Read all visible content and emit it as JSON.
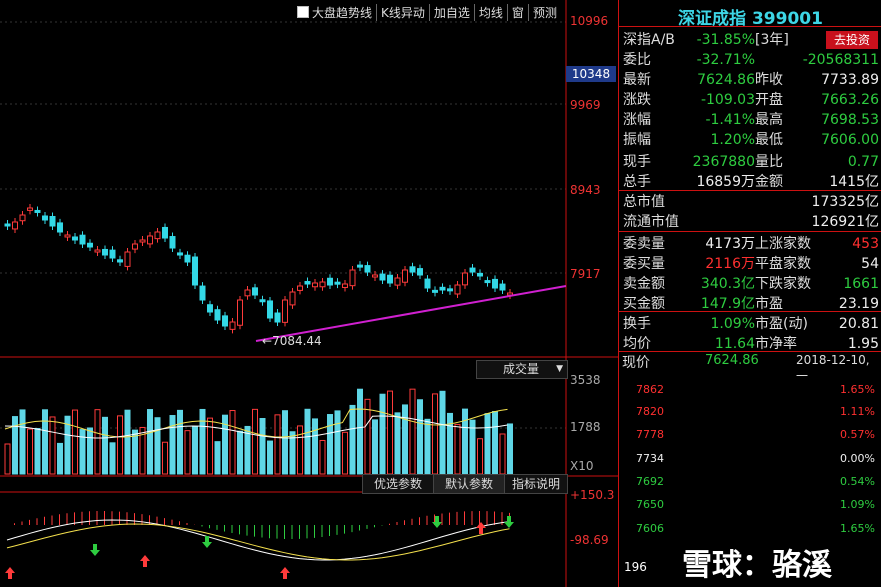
{
  "toolbar": {
    "items": [
      "大盘趋势线",
      "K线异动",
      "加自选",
      "均线",
      "窗",
      "预测"
    ]
  },
  "main_axis": {
    "labels": [
      "10996",
      "10348",
      "9969",
      "8943",
      "7917"
    ],
    "current_tag": "10348",
    "low_label": "7084.44"
  },
  "volume": {
    "title": "成交量",
    "axis_labels": [
      "3538",
      "1788"
    ],
    "unit": "X10"
  },
  "indicator": {
    "tabs": [
      "优选参数",
      "默认参数",
      "指标说明"
    ],
    "axis_labels": [
      "+150.3",
      "-98.69"
    ]
  },
  "panel": {
    "title": "深证成指 399001",
    "invest_button": "去投资",
    "rows": [
      {
        "l": "深指A/B",
        "v1": "-31.85%",
        "v1c": "green",
        "l2": "[3年]",
        "v2": "",
        "v2c": "white"
      },
      {
        "l": "委比",
        "v1": "-32.71%",
        "v1c": "green",
        "l2": "",
        "v2": "-20568311",
        "v2c": "green"
      },
      {
        "l": "最新",
        "v1": "7624.86",
        "v1c": "green",
        "l2": "昨收",
        "v2": "7733.89",
        "v2c": "white"
      },
      {
        "l": "涨跌",
        "v1": "-109.03",
        "v1c": "green",
        "l2": "开盘",
        "v2": "7663.26",
        "v2c": "green"
      },
      {
        "l": "涨幅",
        "v1": "-1.41%",
        "v1c": "green",
        "l2": "最高",
        "v2": "7698.53",
        "v2c": "green"
      },
      {
        "l": "振幅",
        "v1": "1.20%",
        "v1c": "green",
        "l2": "最低",
        "v2": "7606.00",
        "v2c": "green"
      },
      {
        "l": "现手",
        "v1": "2367880",
        "v1c": "green",
        "l2": "量比",
        "v2": "0.77",
        "v2c": "green"
      },
      {
        "l": "总手",
        "v1": "16859万",
        "v1c": "white",
        "l2": "金额",
        "v2": "1415亿",
        "v2c": "white"
      },
      {
        "l": "总市值",
        "v1": "",
        "v1c": "white",
        "l2": "",
        "v2": "173325亿",
        "v2c": "white"
      },
      {
        "l": "流通市值",
        "v1": "",
        "v1c": "white",
        "l2": "",
        "v2": "126921亿",
        "v2c": "white"
      },
      {
        "l": "委卖量",
        "v1": "4173万",
        "v1c": "white",
        "l2": "上涨家数",
        "v2": "453",
        "v2c": "red"
      },
      {
        "l": "委买量",
        "v1": "2116万",
        "v1c": "red",
        "l2": "平盘家数",
        "v2": "54",
        "v2c": "white"
      },
      {
        "l": "卖金额",
        "v1": "340.3亿",
        "v1c": "green",
        "l2": "下跌家数",
        "v2": "1661",
        "v2c": "green"
      },
      {
        "l": "买金额",
        "v1": "147.9亿",
        "v1c": "green",
        "l2": "市盈",
        "v2": "23.19",
        "v2c": "white"
      },
      {
        "l": "换手",
        "v1": "1.09%",
        "v1c": "green",
        "l2": "市盈(动)",
        "v2": "20.81",
        "v2c": "white"
      },
      {
        "l": "均价",
        "v1": "11.64",
        "v1c": "green",
        "l2": "市净率",
        "v2": "1.95",
        "v2c": "white"
      }
    ],
    "price_label": "现价",
    "price_value": "7624.86",
    "date": "2018-12-10,一"
  },
  "intraday": {
    "left_labels": [
      "7862",
      "7820",
      "7778",
      "7734",
      "7692",
      "7650",
      "7606"
    ],
    "right_labels": [
      "1.65%",
      "1.11%",
      "0.57%",
      "0.00%",
      "0.54%",
      "1.09%",
      "1.65%"
    ],
    "vol_label": "196"
  },
  "watermark": "雪球：骆溪"
}
